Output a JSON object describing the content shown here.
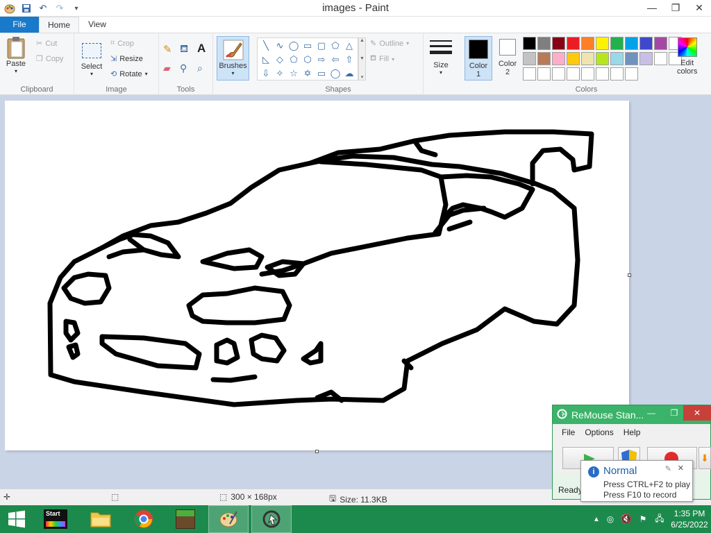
{
  "window": {
    "title": "images - Paint"
  },
  "tabs": {
    "file": "File",
    "home": "Home",
    "view": "View"
  },
  "clipboard": {
    "paste": "Paste",
    "cut": "Cut",
    "copy": "Copy",
    "label": "Clipboard"
  },
  "image": {
    "select": "Select",
    "crop": "Crop",
    "resize": "Resize",
    "rotate": "Rotate",
    "label": "Image"
  },
  "tools": {
    "label": "Tools"
  },
  "brushes": {
    "label": "Brushes"
  },
  "shapes": {
    "outline": "Outline",
    "fill": "Fill",
    "label": "Shapes"
  },
  "size": {
    "label": "Size"
  },
  "colors": {
    "color1_line1": "Color",
    "color1_line2": "1",
    "color2_line1": "Color",
    "color2_line2": "2",
    "edit_line1": "Edit",
    "edit_line2": "colors",
    "label": "Colors",
    "color1_value": "#000000",
    "color2_value": "#ffffff",
    "palette": [
      "#000000",
      "#7f7f7f",
      "#880015",
      "#ed1c24",
      "#ff7f27",
      "#fff200",
      "#22b14c",
      "#00a2e8",
      "#3f48cc",
      "#a349a4",
      "#ffffff",
      "#c3c3c3",
      "#b97a57",
      "#ffaec9",
      "#ffc90e",
      "#efe4b0",
      "#b5e61d",
      "#99d9ea",
      "#7092be",
      "#c8bfe7",
      "#ffffff",
      "#ffffff",
      "#ffffff",
      "#ffffff",
      "#ffffff",
      "#ffffff",
      "#ffffff",
      "#ffffff",
      "#ffffff",
      "#ffffff"
    ]
  },
  "statusbar": {
    "dimensions": "300 × 168px",
    "size": "Size: 11.3KB"
  },
  "remouse": {
    "title": "ReMouse Stan...",
    "menu": [
      "File",
      "Options",
      "Help"
    ],
    "status": "Ready..."
  },
  "tooltip": {
    "title": "Normal",
    "line1": "Press CTRL+F2 to play",
    "line2": "Press F10 to record"
  },
  "taskbar": {
    "start_label": "Start",
    "time": "1:35 PM",
    "date": "6/25/2022"
  }
}
